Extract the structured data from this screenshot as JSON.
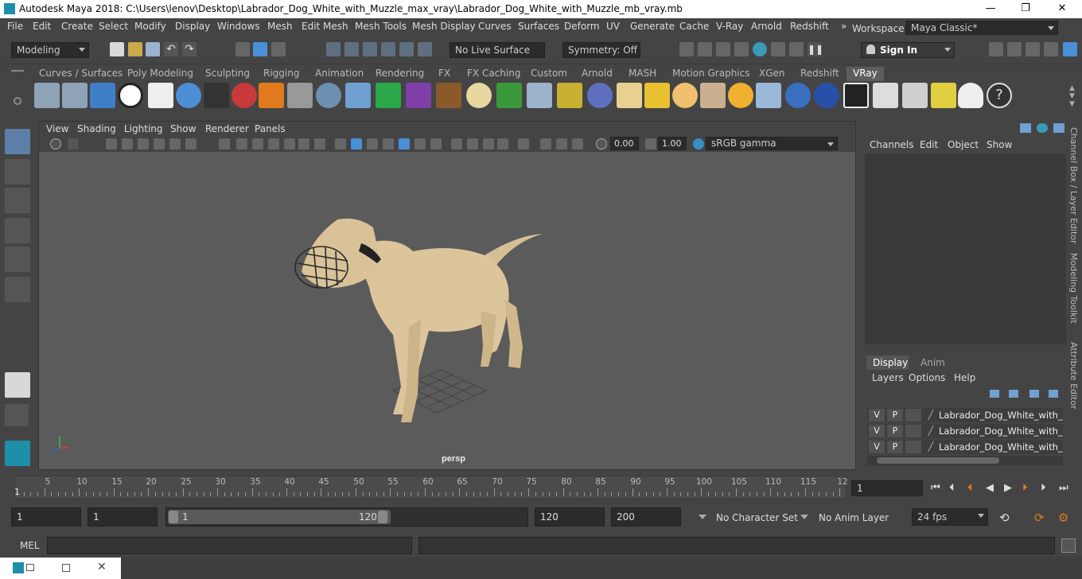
{
  "window": {
    "title": "Autodesk Maya 2018: C:\\Users\\lenov\\Desktop\\Labrador_Dog_White_with_Muzzle_max_vray\\Labrador_Dog_White_with_Muzzle_mb_vray.mb",
    "minimize": "—",
    "maximize": "❐",
    "close": "✕"
  },
  "menubar": {
    "items": [
      "File",
      "Edit",
      "Create",
      "Select",
      "Modify",
      "Display",
      "Windows",
      "Mesh",
      "Edit Mesh",
      "Mesh Tools",
      "Mesh Display",
      "Curves",
      "Surfaces",
      "Deform",
      "UV",
      "Generate",
      "Cache",
      "V-Ray",
      "Arnold",
      "Redshift"
    ],
    "overflow": "»",
    "workspace_label": "Workspace :",
    "workspace_value": "Maya Classic*"
  },
  "statusline": {
    "mode": "Modeling",
    "live_surface": "No Live Surface",
    "symmetry": "Symmetry: Off",
    "sign_in": "Sign In"
  },
  "shelf": {
    "tabs": [
      "Curves / Surfaces",
      "Poly Modeling",
      "Sculpting",
      "Rigging",
      "Animation",
      "Rendering",
      "FX",
      "FX Caching",
      "Custom",
      "Arnold",
      "MASH",
      "Motion Graphics",
      "XGen",
      "Redshift",
      "VRay"
    ],
    "active_tab": "VRay"
  },
  "viewport": {
    "menus": [
      "View",
      "Shading",
      "Lighting",
      "Show",
      "Renderer",
      "Panels"
    ],
    "exposure": "0.00",
    "gamma": "1.00",
    "color_space": "sRGB gamma",
    "camera_label": "persp"
  },
  "channelbox": {
    "menus": [
      "Channels",
      "Edit",
      "Object",
      "Show"
    ]
  },
  "layer_editor": {
    "tabs": [
      "Display",
      "Anim"
    ],
    "active_tab": "Display",
    "menus": [
      "Layers",
      "Options",
      "Help"
    ],
    "layers": [
      {
        "v": "V",
        "p": "P",
        "name": "Labrador_Dog_White_with_Muzzle"
      },
      {
        "v": "V",
        "p": "P",
        "name": "Labrador_Dog_White_with_Muzzle"
      },
      {
        "v": "V",
        "p": "P",
        "name": "Labrador_Dog_White_with_Muzzle"
      }
    ]
  },
  "side_tabs": [
    "Channel Box / Layer Editor",
    "Modeling Toolkit",
    "Attribute Editor"
  ],
  "timeslider": {
    "ticks": [
      "5",
      "10",
      "15",
      "20",
      "25",
      "30",
      "35",
      "40",
      "45",
      "50",
      "55",
      "60",
      "65",
      "70",
      "75",
      "80",
      "85",
      "90",
      "95",
      "100",
      "105",
      "110",
      "115",
      "12"
    ],
    "current_marker": "1",
    "current_frame": "1"
  },
  "range": {
    "start": "1",
    "playback_start": "1",
    "slider_start": "1",
    "slider_end": "120",
    "playback_end": "120",
    "end": "200",
    "character_set": "No Character Set",
    "anim_layer": "No Anim Layer",
    "fps": "24 fps"
  },
  "cmdline": {
    "label": "MEL"
  }
}
